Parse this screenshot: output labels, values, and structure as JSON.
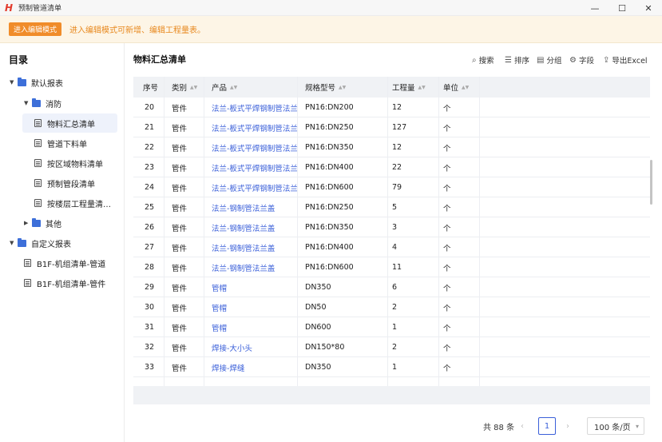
{
  "window": {
    "title": "预制管道清单",
    "logo": "H"
  },
  "banner": {
    "button_label": "进入编辑模式",
    "message": "进入编辑模式可新增、编辑工程量表。"
  },
  "sidebar": {
    "title": "目录",
    "items": [
      {
        "label": "默认报表",
        "type": "folder",
        "expanded": true
      },
      {
        "label": "消防",
        "type": "folder",
        "expanded": true
      },
      {
        "label": "物料汇总清单",
        "type": "doc",
        "active": true
      },
      {
        "label": "管道下料单",
        "type": "doc"
      },
      {
        "label": "按区域物料清单",
        "type": "doc"
      },
      {
        "label": "预制管段清单",
        "type": "doc"
      },
      {
        "label": "按楼层工程量清…",
        "type": "doc"
      },
      {
        "label": "其他",
        "type": "folder",
        "expanded": false
      },
      {
        "label": "自定义报表",
        "type": "folder",
        "expanded": true
      },
      {
        "label": "B1F-机组清单-管道",
        "type": "doc"
      },
      {
        "label": "B1F-机组清单-管件",
        "type": "doc"
      }
    ]
  },
  "main": {
    "title": "物料汇总清单",
    "toolbar": {
      "search": "搜索",
      "sort": "排序",
      "group": "分组",
      "fields": "字段",
      "export": "导出Excel"
    },
    "columns": [
      "序号",
      "类别",
      "产品",
      "规格型号",
      "工程量",
      "单位"
    ],
    "rows": [
      [
        "20",
        "管件",
        "法兰-板式平焊钢制管法兰",
        "PN16:DN200",
        "12",
        "个"
      ],
      [
        "21",
        "管件",
        "法兰-板式平焊钢制管法兰",
        "PN16:DN250",
        "127",
        "个"
      ],
      [
        "22",
        "管件",
        "法兰-板式平焊钢制管法兰",
        "PN16:DN350",
        "12",
        "个"
      ],
      [
        "23",
        "管件",
        "法兰-板式平焊钢制管法兰",
        "PN16:DN400",
        "22",
        "个"
      ],
      [
        "24",
        "管件",
        "法兰-板式平焊钢制管法兰",
        "PN16:DN600",
        "79",
        "个"
      ],
      [
        "25",
        "管件",
        "法兰-钢制管法兰盖",
        "PN16:DN250",
        "5",
        "个"
      ],
      [
        "26",
        "管件",
        "法兰-钢制管法兰盖",
        "PN16:DN350",
        "3",
        "个"
      ],
      [
        "27",
        "管件",
        "法兰-钢制管法兰盖",
        "PN16:DN400",
        "4",
        "个"
      ],
      [
        "28",
        "管件",
        "法兰-钢制管法兰盖",
        "PN16:DN600",
        "11",
        "个"
      ],
      [
        "29",
        "管件",
        "管帽",
        "DN350",
        "6",
        "个"
      ],
      [
        "30",
        "管件",
        "管帽",
        "DN50",
        "2",
        "个"
      ],
      [
        "31",
        "管件",
        "管帽",
        "DN600",
        "1",
        "个"
      ],
      [
        "32",
        "管件",
        "焊接-大小头",
        "DN150*80",
        "2",
        "个"
      ],
      [
        "33",
        "管件",
        "焊接-焊缝",
        "DN350",
        "1",
        "个"
      ]
    ],
    "pagination": {
      "total": "共 88 条",
      "current_page": "1",
      "page_size": "100 条/页"
    }
  },
  "colors": {
    "accent": "#3a5fd9",
    "banner_bg": "#fdf5e6",
    "edit_button": "#f08c2a"
  }
}
